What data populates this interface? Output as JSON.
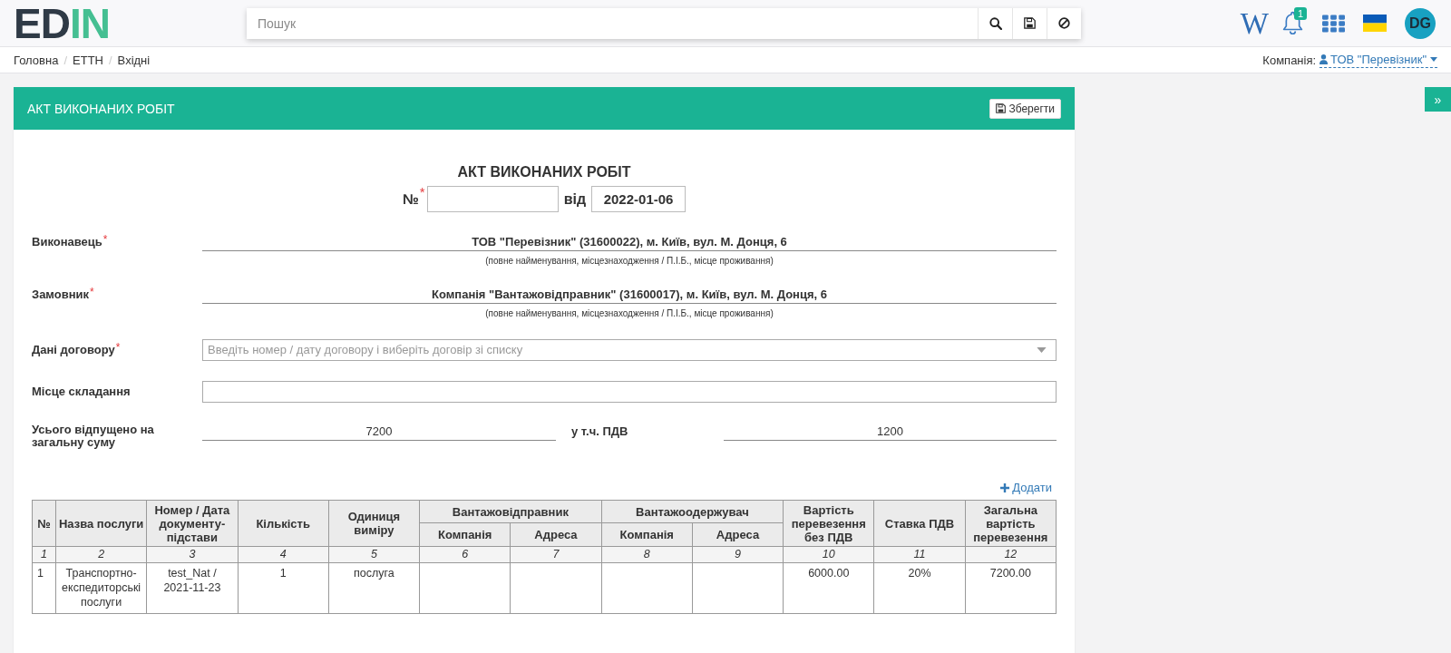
{
  "header": {
    "logo": {
      "dark": "ED",
      "accent": "IN"
    },
    "search": {
      "placeholder": "Пошук"
    },
    "wiki": "W",
    "notifications": {
      "count": "1"
    },
    "avatar": "DG"
  },
  "breadcrumbs": [
    {
      "label": "Головна",
      "separator": "/"
    },
    {
      "label": "ЕТТН",
      "separator": "/"
    },
    {
      "label": "Вхідні"
    }
  ],
  "company": {
    "label": "Компанія:",
    "value": "ТОВ \"Перевізник\""
  },
  "side_toggle": "»",
  "card": {
    "title": "АКТ ВИКОНАНИХ РОБІТ",
    "save_button": "Зберегти"
  },
  "document": {
    "title": "АКТ ВИКОНАНИХ РОБІТ",
    "number_label": "№",
    "number_required_mark": "*",
    "date_label": "від",
    "date": "2022-01-06"
  },
  "fields": [
    {
      "kind": "party",
      "label": "Виконавець",
      "required_mark": "*",
      "value": "ТОВ \"Перевізник\" (31600022), м. Київ, вул. М. Донця, 6",
      "note": "(повне найменування, місцезнаходження / П.І.Б., місце проживання)"
    },
    {
      "kind": "party",
      "label": "Замовник",
      "required_mark": "*",
      "value": "Компанія \"Вантажовідправник\" (31600017), м. Київ, вул. М. Донця, 6",
      "note": "(повне найменування, місцезнаходження / П.І.Б., місце проживання)"
    },
    {
      "kind": "select",
      "label": "Дані договору",
      "required_mark": "*",
      "placeholder": "Введіть номер / дату договору і виберіть договір зі списку"
    },
    {
      "kind": "input",
      "label": "Місце складання"
    },
    {
      "kind": "totals",
      "label": "Усього відпущено на загальну суму",
      "value": "7200",
      "vat_label": "у т.ч. ПДВ",
      "vat_value": "1200"
    }
  ],
  "table": {
    "add_label": "Додати",
    "columns": [
      {
        "kind": "single",
        "label": "№"
      },
      {
        "kind": "single",
        "label": "Назва послуги"
      },
      {
        "kind": "single",
        "label": "Номер / Дата документу-підстави"
      },
      {
        "kind": "single",
        "label": "Кількість"
      },
      {
        "kind": "single",
        "label": "Одиниця виміру"
      },
      {
        "kind": "group",
        "group": "Вантажовідправник",
        "label": "Компанія"
      },
      {
        "kind": "member",
        "label": "Адреса"
      },
      {
        "kind": "group",
        "group": "Вантажоодержувач",
        "label": "Компанія"
      },
      {
        "kind": "member",
        "label": "Адреса"
      },
      {
        "kind": "single",
        "label": "Вартість перевезення без ПДВ"
      },
      {
        "kind": "single",
        "label": "Ставка ПДВ"
      },
      {
        "kind": "single",
        "label": "Загальна вартість перевезення"
      }
    ],
    "column_numbers": [
      "1",
      "2",
      "3",
      "4",
      "5",
      "6",
      "7",
      "8",
      "9",
      "10",
      "11",
      "12"
    ],
    "rows": [
      {
        "cells": [
          "1",
          "Транспортно-експедиторські послуги",
          "test_Nat / 2021-11-23",
          "1",
          "послуга",
          null,
          null,
          null,
          null,
          "6000.00",
          "20%",
          "7200.00"
        ]
      }
    ]
  }
}
